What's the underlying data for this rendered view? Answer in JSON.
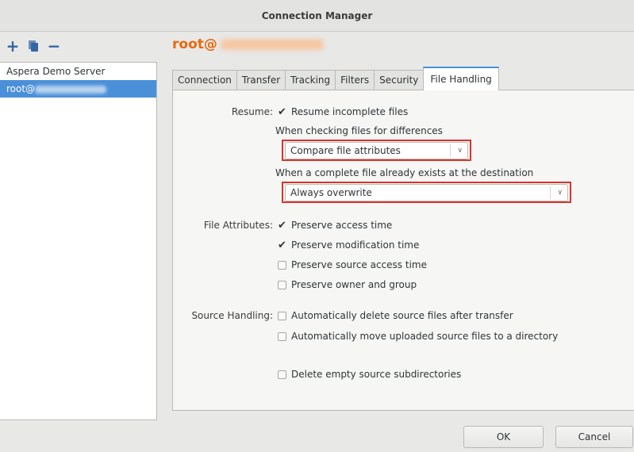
{
  "window": {
    "title": "Connection Manager"
  },
  "toolbar": {
    "add_icon": "plus-icon",
    "duplicate_icon": "duplicate-icon",
    "remove_icon": "minus-icon"
  },
  "servers": [
    {
      "label": "Aspera Demo Server",
      "selected": false
    },
    {
      "label": "root@",
      "selected": true
    }
  ],
  "header": {
    "title": "root@"
  },
  "tabs": [
    {
      "label": "Connection",
      "active": false
    },
    {
      "label": "Transfer",
      "active": false
    },
    {
      "label": "Tracking",
      "active": false
    },
    {
      "label": "Filters",
      "active": false
    },
    {
      "label": "Security",
      "active": false
    },
    {
      "label": "File Handling",
      "active": true
    }
  ],
  "resume": {
    "label": "Resume:",
    "checkbox_label": "Resume incomplete files",
    "checked": true,
    "diff_caption": "When checking files for differences",
    "diff_select": "Compare file attributes",
    "exists_caption": "When a complete file already exists at the destination",
    "exists_select": "Always overwrite"
  },
  "file_attributes": {
    "label": "File Attributes:",
    "options": [
      {
        "label": "Preserve access time",
        "checked": true
      },
      {
        "label": "Preserve modification time",
        "checked": true
      },
      {
        "label": "Preserve source access time",
        "checked": false
      },
      {
        "label": "Preserve owner and group",
        "checked": false
      }
    ]
  },
  "source_handling": {
    "label": "Source Handling:",
    "options": [
      {
        "label": "Automatically delete source files after transfer",
        "checked": false
      },
      {
        "label": "Automatically move uploaded source files to a directory",
        "checked": false
      },
      {
        "label": "Delete empty source subdirectories",
        "checked": false
      }
    ]
  },
  "buttons": {
    "ok": "OK",
    "cancel": "Cancel"
  },
  "colors": {
    "accent": "#4a90d9",
    "title": "#e8690b",
    "highlight": "#d9342b"
  }
}
